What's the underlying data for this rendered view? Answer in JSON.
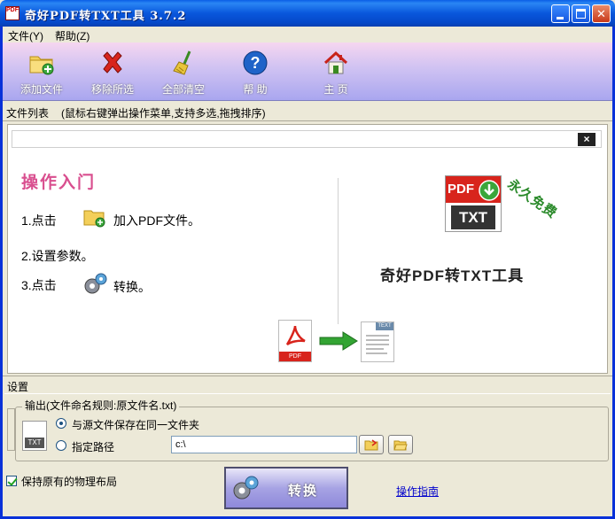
{
  "window": {
    "title": "奇好PDF转TXT工具 3.7.2",
    "icon_text": "PDF"
  },
  "menu": {
    "file": "文件(Y)",
    "help": "帮助(Z)"
  },
  "toolbar": {
    "items": [
      {
        "label": "添加文件",
        "icon": "add-folder-icon"
      },
      {
        "label": "移除所选",
        "icon": "red-x-icon"
      },
      {
        "label": "全部清空",
        "icon": "broom-icon"
      },
      {
        "label": "帮 助",
        "icon": "help-question-icon"
      },
      {
        "label": "主 页",
        "icon": "home-icon"
      }
    ]
  },
  "file_list": {
    "label": "文件列表",
    "hint": "(鼠标右键弹出操作菜单,支持多选,拖拽排序)"
  },
  "intro": {
    "close": "×",
    "title": "操作入门",
    "step1_prefix": "1.点击",
    "step1_suffix": "加入PDF文件。",
    "step2": "2.设置参数。",
    "step3_prefix": "3.点击",
    "step3_suffix": "转换。",
    "product_name": "奇好PDF转TXT工具",
    "free_badge": "永久免费",
    "logo_top": "PDF",
    "logo_bottom": "TXT",
    "pdf_icon_label": "PDF",
    "txt_doc_label": "TEXT"
  },
  "settings": {
    "header": "设置",
    "output_legend": "输出(文件命名规则:原文件名.txt)",
    "txt_badge": "TXT",
    "option_same_folder": "与源文件保存在同一文件夹",
    "option_custom_path": "指定路径",
    "path_value": "c:\\",
    "selected_option": "same_folder"
  },
  "bottom": {
    "keep_layout": "保持原有的物理布局",
    "keep_layout_checked": true,
    "convert": "转换",
    "guide": "操作指南"
  },
  "colors": {
    "title_blue": "#0a5ee6",
    "toolbar_purple": "#a9a6ef",
    "intro_pink": "#d94f8f",
    "free_green": "#2a8a2a",
    "link_blue": "#0000cc"
  }
}
